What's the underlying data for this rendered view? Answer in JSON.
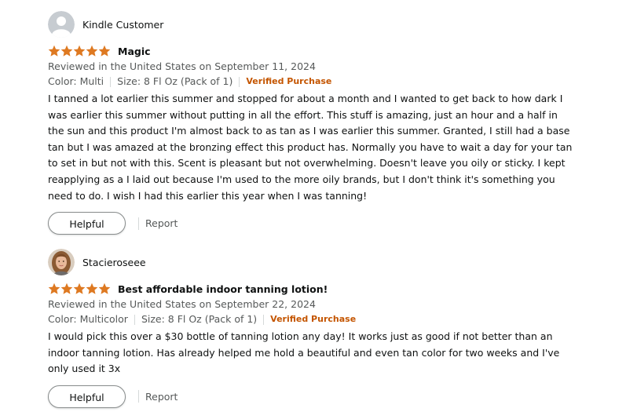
{
  "colors": {
    "star": "#de7921",
    "verified": "#c45500",
    "muted_text": "#565959",
    "main_text": "#0f1111"
  },
  "reviews": [
    {
      "reviewer_name": "Kindle Customer",
      "avatar": "default-person-icon",
      "rating": 5,
      "title": "Magic",
      "reviewed_line": "Reviewed in the United States on September 11, 2024",
      "color": "Color: Multi",
      "size": "Size: 8 Fl Oz (Pack of 1)",
      "verified": "Verified Purchase",
      "body": "I tanned a lot earlier this summer and stopped for about a month and I wanted to get back to how dark I was earlier this summer without putting in all the effort. This stuff is amazing, just an hour and a half in the sun and this product I'm almost back to as tan as I was earlier this summer. Granted, I still had a base tan but I was amazed at the bronzing effect this product has. Normally you have to wait a day for your tan to set in but not with this. Scent is pleasant but not overwhelming. Doesn't leave you oily or sticky. I kept reapplying as a I laid out because I'm used to the more oily brands, but I don't think it's something you need to do. I wish I had this earlier this year when I was tanning!",
      "helpful_label": "Helpful",
      "report_label": "Report"
    },
    {
      "reviewer_name": "Stacieroseee",
      "avatar": "profile-photo",
      "rating": 5,
      "title": "Best affordable indoor tanning lotion!",
      "reviewed_line": "Reviewed in the United States on September 22, 2024",
      "color": "Color: Multicolor",
      "size": "Size: 8 Fl Oz (Pack of 1)",
      "verified": "Verified Purchase",
      "body": "I would pick this over a $30 bottle of tanning lotion any day! It works just as good if not better than an indoor tanning lotion. Has already helped me hold a beautiful and even tan color for two weeks and I've only used it 3x",
      "helpful_label": "Helpful",
      "report_label": "Report"
    }
  ]
}
